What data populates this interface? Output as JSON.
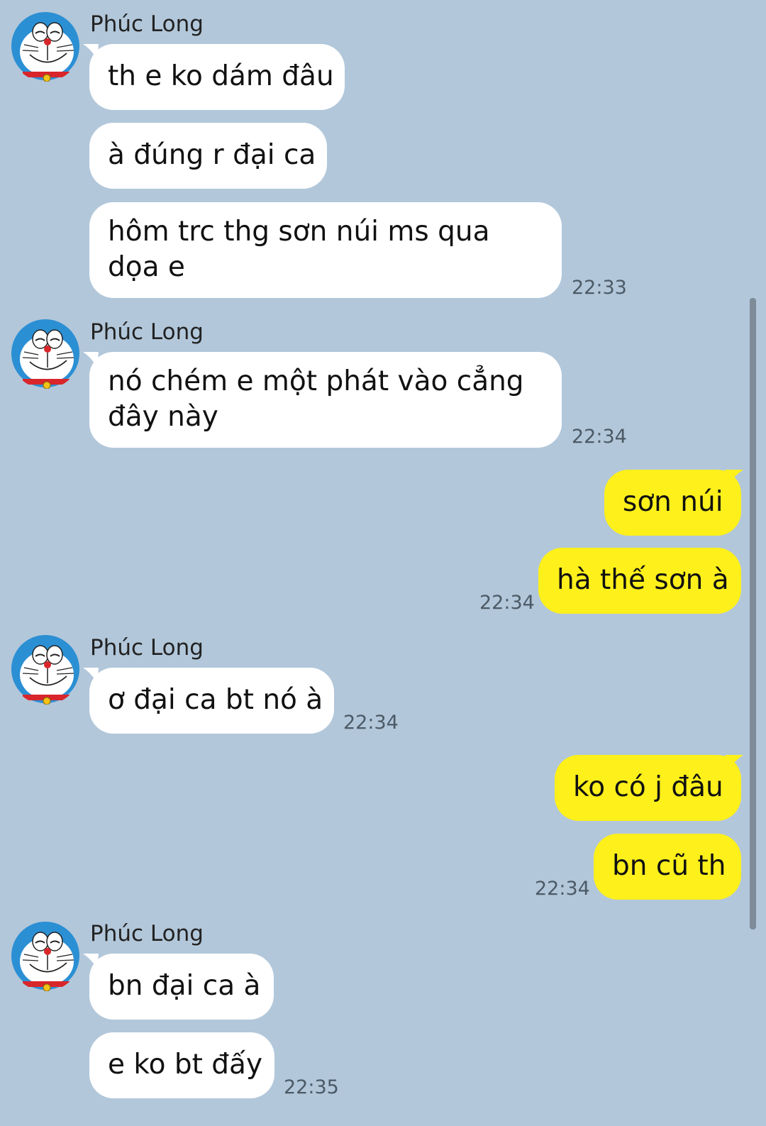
{
  "chat": {
    "contact_name": "Phúc Long",
    "messages": [
      {
        "text": "th e ko dám đâu"
      },
      {
        "text": "à đúng r đại ca"
      },
      {
        "text": "hôm trc thg sơn núi ms qua dọa e",
        "time": "22:33"
      },
      {
        "text": "nó chém e một phát vào cẳng đây này",
        "time": "22:34"
      },
      {
        "text": "sơn núi"
      },
      {
        "text": "hà thế sơn à",
        "time": "22:34"
      },
      {
        "text": "ơ đại ca bt nó à",
        "time": "22:34"
      },
      {
        "text": "ko có j đâu"
      },
      {
        "text": "bn cũ th",
        "time": "22:34"
      },
      {
        "text": "bn đại ca à"
      },
      {
        "text": "e ko bt đấy",
        "time": "22:35"
      }
    ]
  },
  "colors": {
    "background": "#b2c7da",
    "incoming_bubble": "#ffffff",
    "outgoing_bubble": "#fef01b"
  },
  "icons": {
    "avatar": "doraemon-avatar-icon"
  }
}
